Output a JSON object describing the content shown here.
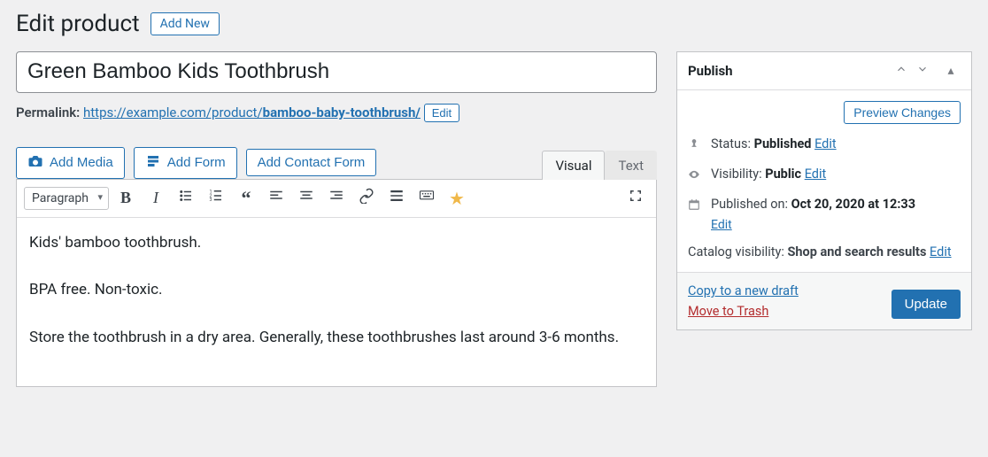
{
  "page": {
    "heading": "Edit product",
    "add_new": "Add New"
  },
  "product": {
    "title": "Green Bamboo Kids Toothbrush",
    "permalink_label": "Permalink:",
    "permalink_base": "https://example.com/product/",
    "permalink_slug": "bamboo-baby-toothbrush/",
    "edit_label": "Edit"
  },
  "editor": {
    "add_media": "Add Media",
    "add_form": "Add Form",
    "add_contact_form": "Add Contact Form",
    "tab_visual": "Visual",
    "tab_text": "Text",
    "format_select": "Paragraph",
    "content_p1": "Kids' bamboo toothbrush.",
    "content_p2": "BPA free. Non-toxic.",
    "content_p3": "Store the toothbrush in a dry area. Generally, these toothbrushes last around 3-6 months."
  },
  "publish": {
    "box_title": "Publish",
    "preview": "Preview Changes",
    "status_label": "Status:",
    "status_value": "Published",
    "status_edit": "Edit",
    "visibility_label": "Visibility:",
    "visibility_value": "Public",
    "visibility_edit": "Edit",
    "published_label": "Published on:",
    "published_value": "Oct 20, 2020 at 12:33",
    "published_edit": "Edit",
    "catalog_label": "Catalog visibility:",
    "catalog_value": "Shop and search results",
    "catalog_edit": "Edit",
    "copy_draft": "Copy to a new draft",
    "trash": "Move to Trash",
    "update": "Update"
  }
}
